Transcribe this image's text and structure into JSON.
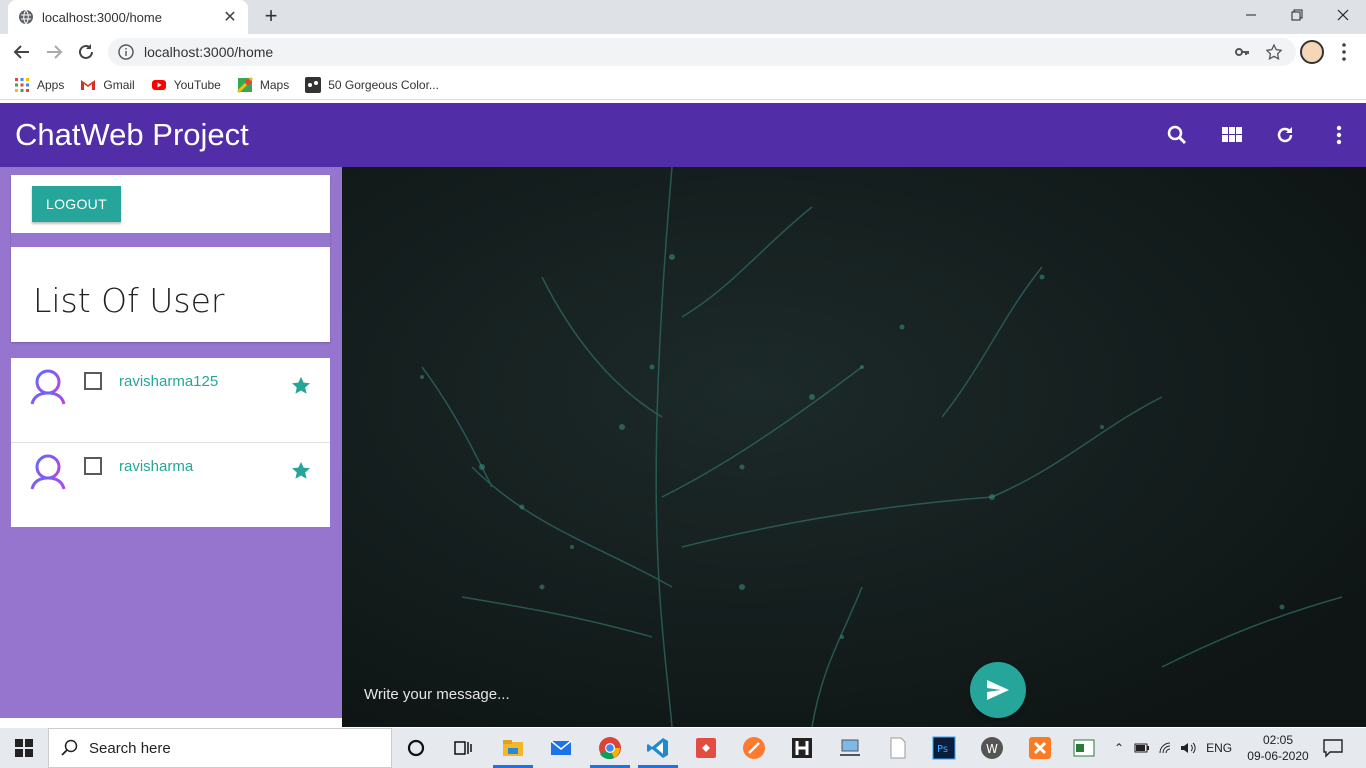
{
  "browser": {
    "tab_title": "localhost:3000/home",
    "url": "localhost:3000/home",
    "bookmarks": [
      {
        "label": "Apps",
        "icon": "apps-grid-icon"
      },
      {
        "label": "Gmail",
        "icon": "gmail-icon"
      },
      {
        "label": "YouTube",
        "icon": "youtube-icon"
      },
      {
        "label": "Maps",
        "icon": "maps-icon"
      },
      {
        "label": "50 Gorgeous Color...",
        "icon": "bookmark-site-icon"
      }
    ]
  },
  "app": {
    "title": "ChatWeb Project",
    "logout_label": "LOGOUT",
    "list_title": "List Of User",
    "users": [
      {
        "name": "ravisharma125"
      },
      {
        "name": "ravisharma"
      }
    ],
    "message_placeholder": "Write your message...",
    "colors": {
      "primary": "#512da8",
      "sidebar": "#9575cd",
      "accent": "#26a69a"
    }
  },
  "taskbar": {
    "search_placeholder": "Search here",
    "language": "ENG",
    "time": "02:05",
    "date": "09-06-2020"
  }
}
